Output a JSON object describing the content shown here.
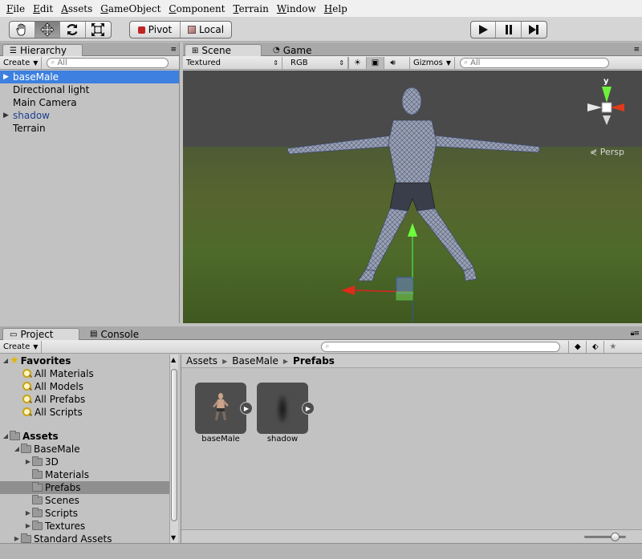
{
  "menu": [
    {
      "label": "File",
      "u": "F",
      "rest": "ile"
    },
    {
      "label": "Edit",
      "u": "E",
      "rest": "dit"
    },
    {
      "label": "Assets",
      "u": "A",
      "rest": "ssets"
    },
    {
      "label": "GameObject",
      "u": "G",
      "rest": "ameObject"
    },
    {
      "label": "Component",
      "u": "C",
      "rest": "omponent"
    },
    {
      "label": "Terrain",
      "u": "T",
      "rest": "errain"
    },
    {
      "label": "Window",
      "u": "W",
      "rest": "indow"
    },
    {
      "label": "Help",
      "u": "H",
      "rest": "elp"
    }
  ],
  "toolbar": {
    "tools": [
      "hand-icon",
      "move-icon",
      "rotate-icon",
      "scale-icon"
    ],
    "active_tool": "move-icon",
    "pivot_label": "Pivot",
    "local_label": "Local",
    "play_icons": [
      "play-icon",
      "pause-icon",
      "step-icon"
    ]
  },
  "hierarchy": {
    "tab_label": "Hierarchy",
    "create_label": "Create",
    "search_placeholder": "All",
    "items": [
      {
        "label": "baseMale",
        "foldout": true,
        "selected": true,
        "prefab": true
      },
      {
        "label": "Directional light",
        "foldout": false,
        "selected": false,
        "prefab": false
      },
      {
        "label": "Main Camera",
        "foldout": false,
        "selected": false,
        "prefab": false
      },
      {
        "label": "shadow",
        "foldout": true,
        "selected": false,
        "prefab": true
      },
      {
        "label": "Terrain",
        "foldout": false,
        "selected": false,
        "prefab": false
      }
    ]
  },
  "scene": {
    "tab_scene": "Scene",
    "tab_game": "Game",
    "render_mode": "Textured",
    "color_mode": "RGB",
    "gizmos_label": "Gizmos",
    "search_placeholder": "All",
    "persp_label": "Persp",
    "axis_y": "y"
  },
  "project": {
    "tab_project": "Project",
    "tab_console": "Console",
    "create_label": "Create",
    "search_placeholder": "",
    "favorites_label": "Favorites",
    "favorites": [
      "All Materials",
      "All Models",
      "All Prefabs",
      "All Scripts"
    ],
    "assets_label": "Assets",
    "tree": [
      {
        "label": "BaseMale",
        "depth": 1,
        "fold": "open",
        "selected": false
      },
      {
        "label": "3D",
        "depth": 2,
        "fold": "closed",
        "selected": false
      },
      {
        "label": "Materials",
        "depth": 2,
        "fold": "none",
        "selected": false
      },
      {
        "label": "Prefabs",
        "depth": 2,
        "fold": "none",
        "selected": true
      },
      {
        "label": "Scenes",
        "depth": 2,
        "fold": "none",
        "selected": false
      },
      {
        "label": "Scripts",
        "depth": 2,
        "fold": "closed",
        "selected": false
      },
      {
        "label": "Textures",
        "depth": 2,
        "fold": "closed",
        "selected": false
      },
      {
        "label": "Standard Assets",
        "depth": 1,
        "fold": "closed",
        "selected": false
      }
    ],
    "breadcrumb": [
      "Assets",
      "BaseMale",
      "Prefabs"
    ],
    "assets": [
      {
        "label": "baseMale",
        "kind": "figure"
      },
      {
        "label": "shadow",
        "kind": "blur"
      }
    ]
  }
}
